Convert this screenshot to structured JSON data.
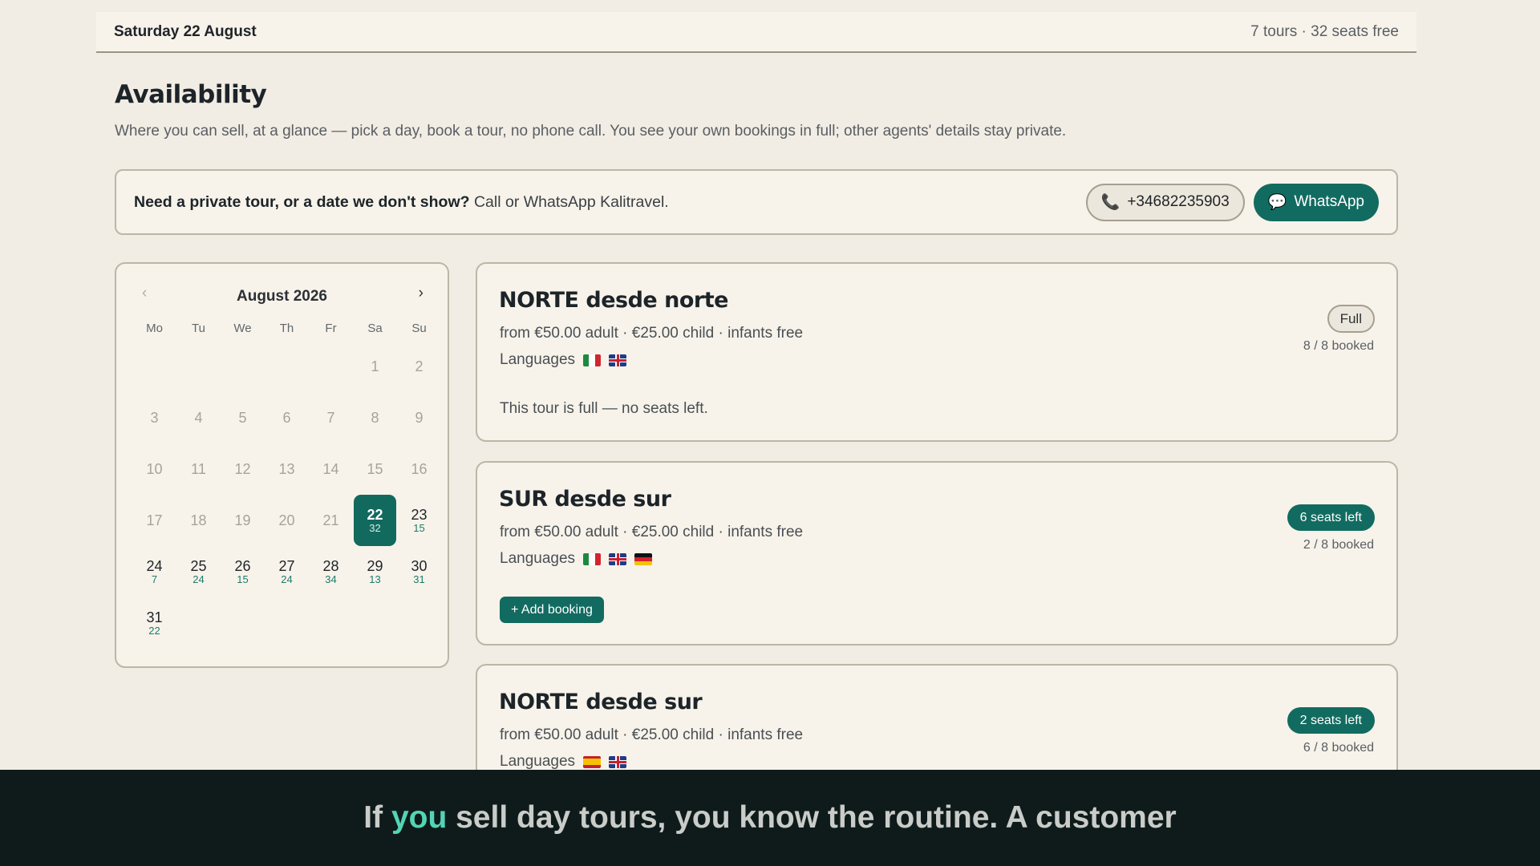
{
  "topbar": {
    "date": "Saturday 22 August",
    "summary": "7 tours · 32 seats free"
  },
  "header": {
    "title": "Availability",
    "subtitle": "Where you can sell, at a glance — pick a day, book a tour, no phone call. You see your own bookings in full; other agents' details stay private."
  },
  "private_tour": {
    "question": "Need a private tour, or a date we don't show?",
    "text": "Call or WhatsApp Kalitravel.",
    "phone": "+34682235903",
    "whatsapp_label": "WhatsApp",
    "phone_icon": "phone-icon",
    "chat_icon": "chat-bubble-icon"
  },
  "calendar": {
    "month": "August 2026",
    "prev_symbol": "‹",
    "next_symbol": "›",
    "weekdays": [
      "Mo",
      "Tu",
      "We",
      "Th",
      "Fr",
      "Sa",
      "Su"
    ],
    "days": [
      {
        "day": "",
        "seats": "",
        "state": "empty"
      },
      {
        "day": "",
        "seats": "",
        "state": "empty"
      },
      {
        "day": "",
        "seats": "",
        "state": "empty"
      },
      {
        "day": "",
        "seats": "",
        "state": "empty"
      },
      {
        "day": "",
        "seats": "",
        "state": "empty"
      },
      {
        "day": "1",
        "seats": "",
        "state": "past"
      },
      {
        "day": "2",
        "seats": "",
        "state": "past"
      },
      {
        "day": "3",
        "seats": "",
        "state": "past"
      },
      {
        "day": "4",
        "seats": "",
        "state": "past"
      },
      {
        "day": "5",
        "seats": "",
        "state": "past"
      },
      {
        "day": "6",
        "seats": "",
        "state": "past"
      },
      {
        "day": "7",
        "seats": "",
        "state": "past"
      },
      {
        "day": "8",
        "seats": "",
        "state": "past"
      },
      {
        "day": "9",
        "seats": "",
        "state": "past"
      },
      {
        "day": "10",
        "seats": "",
        "state": "past"
      },
      {
        "day": "11",
        "seats": "",
        "state": "past"
      },
      {
        "day": "12",
        "seats": "",
        "state": "past"
      },
      {
        "day": "13",
        "seats": "",
        "state": "past"
      },
      {
        "day": "14",
        "seats": "",
        "state": "past"
      },
      {
        "day": "15",
        "seats": "",
        "state": "past"
      },
      {
        "day": "16",
        "seats": "",
        "state": "past"
      },
      {
        "day": "17",
        "seats": "",
        "state": "past"
      },
      {
        "day": "18",
        "seats": "",
        "state": "past"
      },
      {
        "day": "19",
        "seats": "",
        "state": "past"
      },
      {
        "day": "20",
        "seats": "",
        "state": "past"
      },
      {
        "day": "21",
        "seats": "",
        "state": "past"
      },
      {
        "day": "22",
        "seats": "32",
        "state": "selected"
      },
      {
        "day": "23",
        "seats": "15",
        "state": "future"
      },
      {
        "day": "24",
        "seats": "7",
        "state": "future"
      },
      {
        "day": "25",
        "seats": "24",
        "state": "future"
      },
      {
        "day": "26",
        "seats": "15",
        "state": "future"
      },
      {
        "day": "27",
        "seats": "24",
        "state": "future"
      },
      {
        "day": "28",
        "seats": "34",
        "state": "future"
      },
      {
        "day": "29",
        "seats": "13",
        "state": "future"
      },
      {
        "day": "30",
        "seats": "31",
        "state": "future"
      },
      {
        "day": "31",
        "seats": "22",
        "state": "future"
      }
    ]
  },
  "tours": [
    {
      "name": "NORTE desde norte",
      "prices": "from €50.00 adult · €25.00 child · infants free",
      "languages_label": "Languages",
      "languages": [
        "it",
        "gb"
      ],
      "status": "Full",
      "status_kind": "full",
      "booked": "8 / 8 booked",
      "note": "This tour is full — no seats left."
    },
    {
      "name": "SUR desde sur",
      "prices": "from €50.00 adult · €25.00 child · infants free",
      "languages_label": "Languages",
      "languages": [
        "it",
        "gb",
        "de"
      ],
      "status": "6 seats left",
      "status_kind": "available",
      "booked": "2 / 8 booked",
      "action": "+ Add booking"
    },
    {
      "name": "NORTE desde sur",
      "prices": "from €50.00 adult · €25.00 child · infants free",
      "languages_label": "Languages",
      "languages": [
        "es",
        "gb"
      ],
      "status": "2 seats left",
      "status_kind": "available",
      "booked": "6 / 8 booked"
    }
  ],
  "caption": {
    "before": "If ",
    "highlight": "you",
    "after": " sell day tours, you know the routine. A customer"
  },
  "colors": {
    "accent": "#126b60",
    "background": "#f1ede4",
    "card": "#f7f3ea",
    "caption_bg": "#0f1b1b",
    "caption_highlight": "#54d4b4"
  }
}
